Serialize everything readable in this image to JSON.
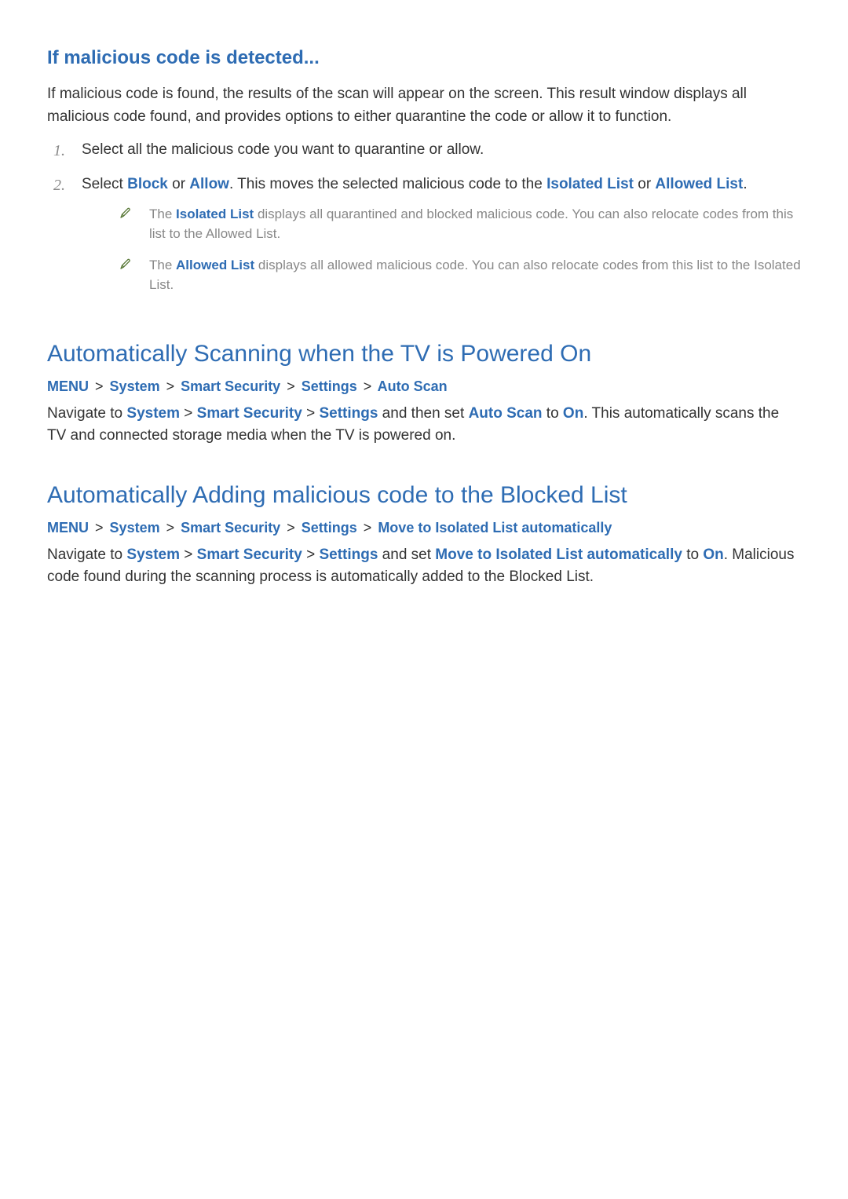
{
  "section1": {
    "heading": "If malicious code is detected...",
    "intro": "If malicious code is found, the results of the scan will appear on the screen. This result window displays all malicious code found, and provides options to either quarantine the code or allow it to function.",
    "step1_num": "1.",
    "step1": "Select all the malicious code you want to quarantine or allow.",
    "step2_num": "2.",
    "step2_a": "Select ",
    "step2_block": "Block",
    "step2_b": " or ",
    "step2_allow": "Allow",
    "step2_c": ". This moves the selected malicious code to the ",
    "step2_isolated": "Isolated List",
    "step2_d": " or ",
    "step2_allowed": "Allowed List",
    "step2_e": ".",
    "note1_a": "The ",
    "note1_bold": "Isolated List",
    "note1_b": " displays all quarantined and blocked malicious code. You can also relocate codes from this list to the Allowed List.",
    "note2_a": "The ",
    "note2_bold": "Allowed List",
    "note2_b": " displays all allowed malicious code. You can also relocate codes from this list to the Isolated List."
  },
  "section2": {
    "heading": "Automatically Scanning when the TV is Powered On",
    "path": {
      "p1": "MENU",
      "p2": "System",
      "p3": "Smart Security",
      "p4": "Settings",
      "p5": "Auto Scan",
      "sep": ">"
    },
    "body_a": "Navigate to ",
    "body_sys": "System",
    "body_sep1": " > ",
    "body_ss": "Smart Security",
    "body_sep2": " > ",
    "body_set": "Settings",
    "body_b": " and then set ",
    "body_as": "Auto Scan",
    "body_c": " to ",
    "body_on": "On",
    "body_d": ". This automatically scans the TV and connected storage media when the TV is powered on."
  },
  "section3": {
    "heading": "Automatically Adding malicious code to the Blocked List",
    "path": {
      "p1": "MENU",
      "p2": "System",
      "p3": "Smart Security",
      "p4": "Settings",
      "p5": "Move to Isolated List automatically",
      "sep": ">"
    },
    "body_a": "Navigate to ",
    "body_sys": "System",
    "body_sep1": " > ",
    "body_ss": "Smart Security",
    "body_sep2": " > ",
    "body_set": "Settings",
    "body_b": " and set ",
    "body_move": "Move to Isolated List automatically",
    "body_c": " to ",
    "body_on": "On",
    "body_d": ". Malicious code found during the scanning process is automatically added to the Blocked List."
  }
}
